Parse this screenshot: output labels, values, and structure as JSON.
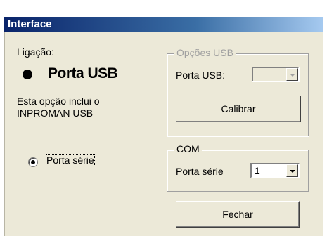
{
  "window": {
    "title": "Interface"
  },
  "left": {
    "connection_label": "Ligação:",
    "usb_option_label": "Porta USB",
    "usb_note_line1": "Esta opção inclui o",
    "usb_note_line2": "INPROMAN USB",
    "serial_option_label": "Porta série",
    "serial_selected": true
  },
  "usb_group": {
    "title": "Opções USB",
    "port_label": "Porta USB:",
    "port_value": "",
    "calibrate_label": "Calibrar"
  },
  "com_group": {
    "title": "COM",
    "port_label": "Porta série",
    "port_value": "1"
  },
  "close_label": "Fechar"
}
